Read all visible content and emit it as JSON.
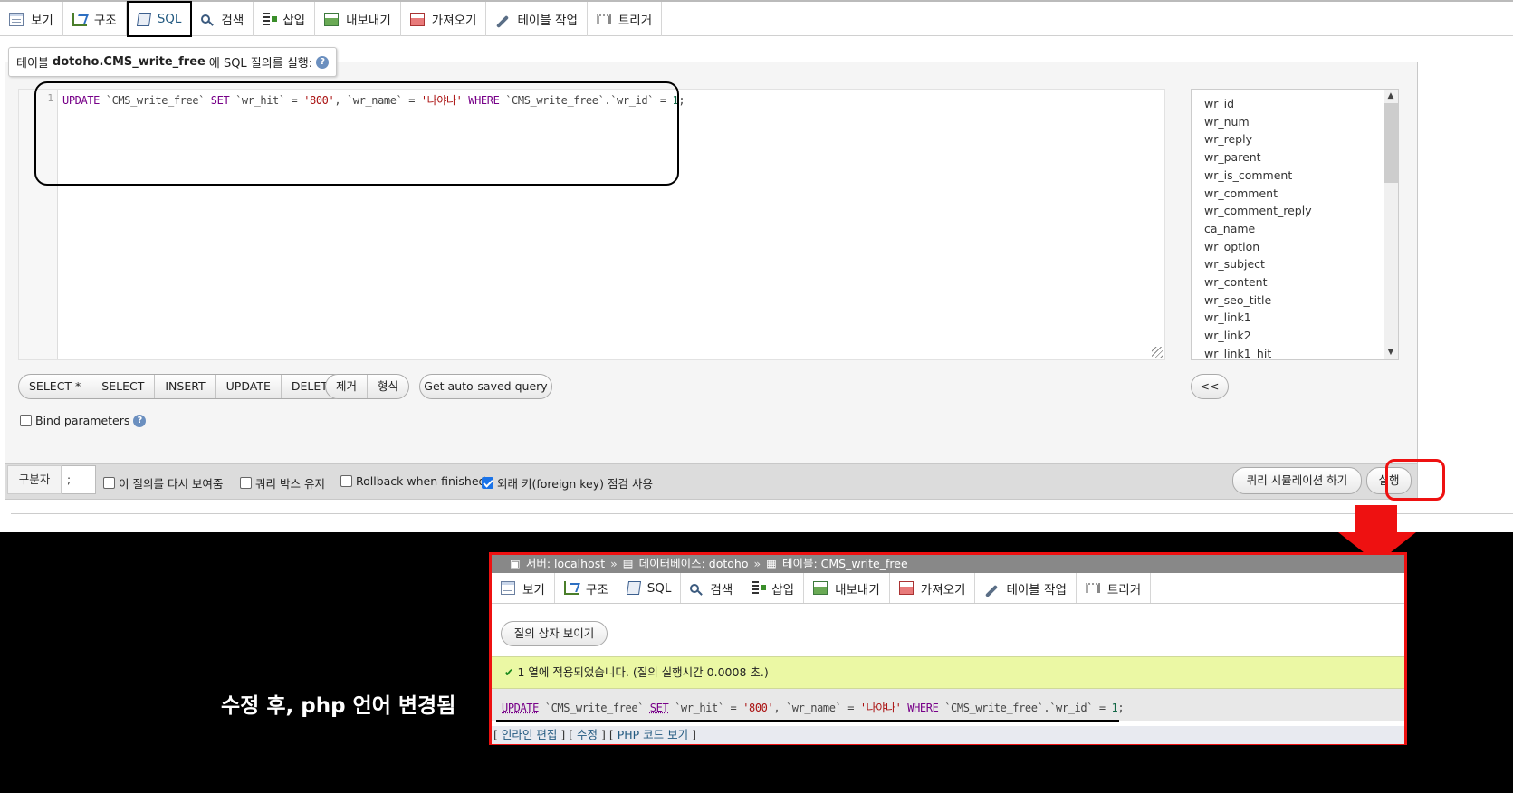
{
  "top_tabs": [
    {
      "label": "보기",
      "icon": "browse-icon"
    },
    {
      "label": "구조",
      "icon": "structure-icon"
    },
    {
      "label": "SQL",
      "icon": "sql-icon"
    },
    {
      "label": "검색",
      "icon": "search-icon"
    },
    {
      "label": "삽입",
      "icon": "insert-icon"
    },
    {
      "label": "내보내기",
      "icon": "export-icon"
    },
    {
      "label": "가져오기",
      "icon": "import-icon"
    },
    {
      "label": "테이블 작업",
      "icon": "wrench-icon"
    },
    {
      "label": "트리거",
      "icon": "trigger-icon"
    }
  ],
  "query_panel": {
    "legend_prefix": "테이블 ",
    "legend_table": "dotoho.CMS_write_free",
    "legend_suffix": "에 SQL 질의를 실행:"
  },
  "editor": {
    "line_number": "1",
    "code": {
      "t1": "UPDATE",
      "t2": " `CMS_write_free` ",
      "t3": "SET",
      "t4": " `wr_hit` = ",
      "t5": "'800'",
      "t6": ", `wr_name` = ",
      "t7": "'나야나'",
      "t8": " ",
      "t9": "WHERE",
      "t10": " `CMS_write_free`.`wr_id` = ",
      "t11": "1",
      "t12": ";"
    }
  },
  "columns": [
    "wr_id",
    "wr_num",
    "wr_reply",
    "wr_parent",
    "wr_is_comment",
    "wr_comment",
    "wr_comment_reply",
    "ca_name",
    "wr_option",
    "wr_subject",
    "wr_content",
    "wr_seo_title",
    "wr_link1",
    "wr_link2",
    "wr_link1_hit"
  ],
  "sql_buttons": [
    "SELECT *",
    "SELECT",
    "INSERT",
    "UPDATE",
    "DELETE"
  ],
  "format_buttons": [
    "제거",
    "형식"
  ],
  "autosave_label": "Get auto-saved query",
  "insert_column_label": "<<",
  "bind_parameters_label": "Bind parameters",
  "options": {
    "delimiter_label": "구분자",
    "delimiter_value": ";",
    "show_again": "이 질의를 다시 보여줌",
    "retain_box": "쿼리 박스 유지",
    "rollback": "Rollback when finished",
    "fk_check": "외래 키(foreign key) 점검 사용"
  },
  "simulate_label": "쿼리 시뮬레이션 하기",
  "go_label": "실행",
  "result": {
    "crumb_server": "서버: localhost",
    "crumb_db": "데이터베이스: dotoho",
    "crumb_table": "테이블: CMS_write_free",
    "crumb_sep": "»",
    "tabs": [
      {
        "label": "보기",
        "icon": "browse-icon"
      },
      {
        "label": "구조",
        "icon": "structure-icon"
      },
      {
        "label": "SQL",
        "icon": "sql-icon"
      },
      {
        "label": "검색",
        "icon": "search-icon"
      },
      {
        "label": "삽입",
        "icon": "insert-icon"
      },
      {
        "label": "내보내기",
        "icon": "export-icon"
      },
      {
        "label": "가져오기",
        "icon": "import-icon"
      },
      {
        "label": "테이블 작업",
        "icon": "wrench-icon"
      },
      {
        "label": "트리거",
        "icon": "trigger-icon"
      }
    ],
    "show_query_box": "질의 상자 보이기",
    "success_message": "1 열에 적용되었습니다. (질의 실행시간 0.0008 초.)",
    "inline_edit": "인라인 편집",
    "edit": "수정",
    "php_code": "PHP 코드 보기"
  },
  "caption": "수정 후, php 언어 변경됨",
  "colors": {
    "accent_red": "#e11111",
    "link_blue": "#235a81",
    "success_bg": "#ebf8a4"
  }
}
